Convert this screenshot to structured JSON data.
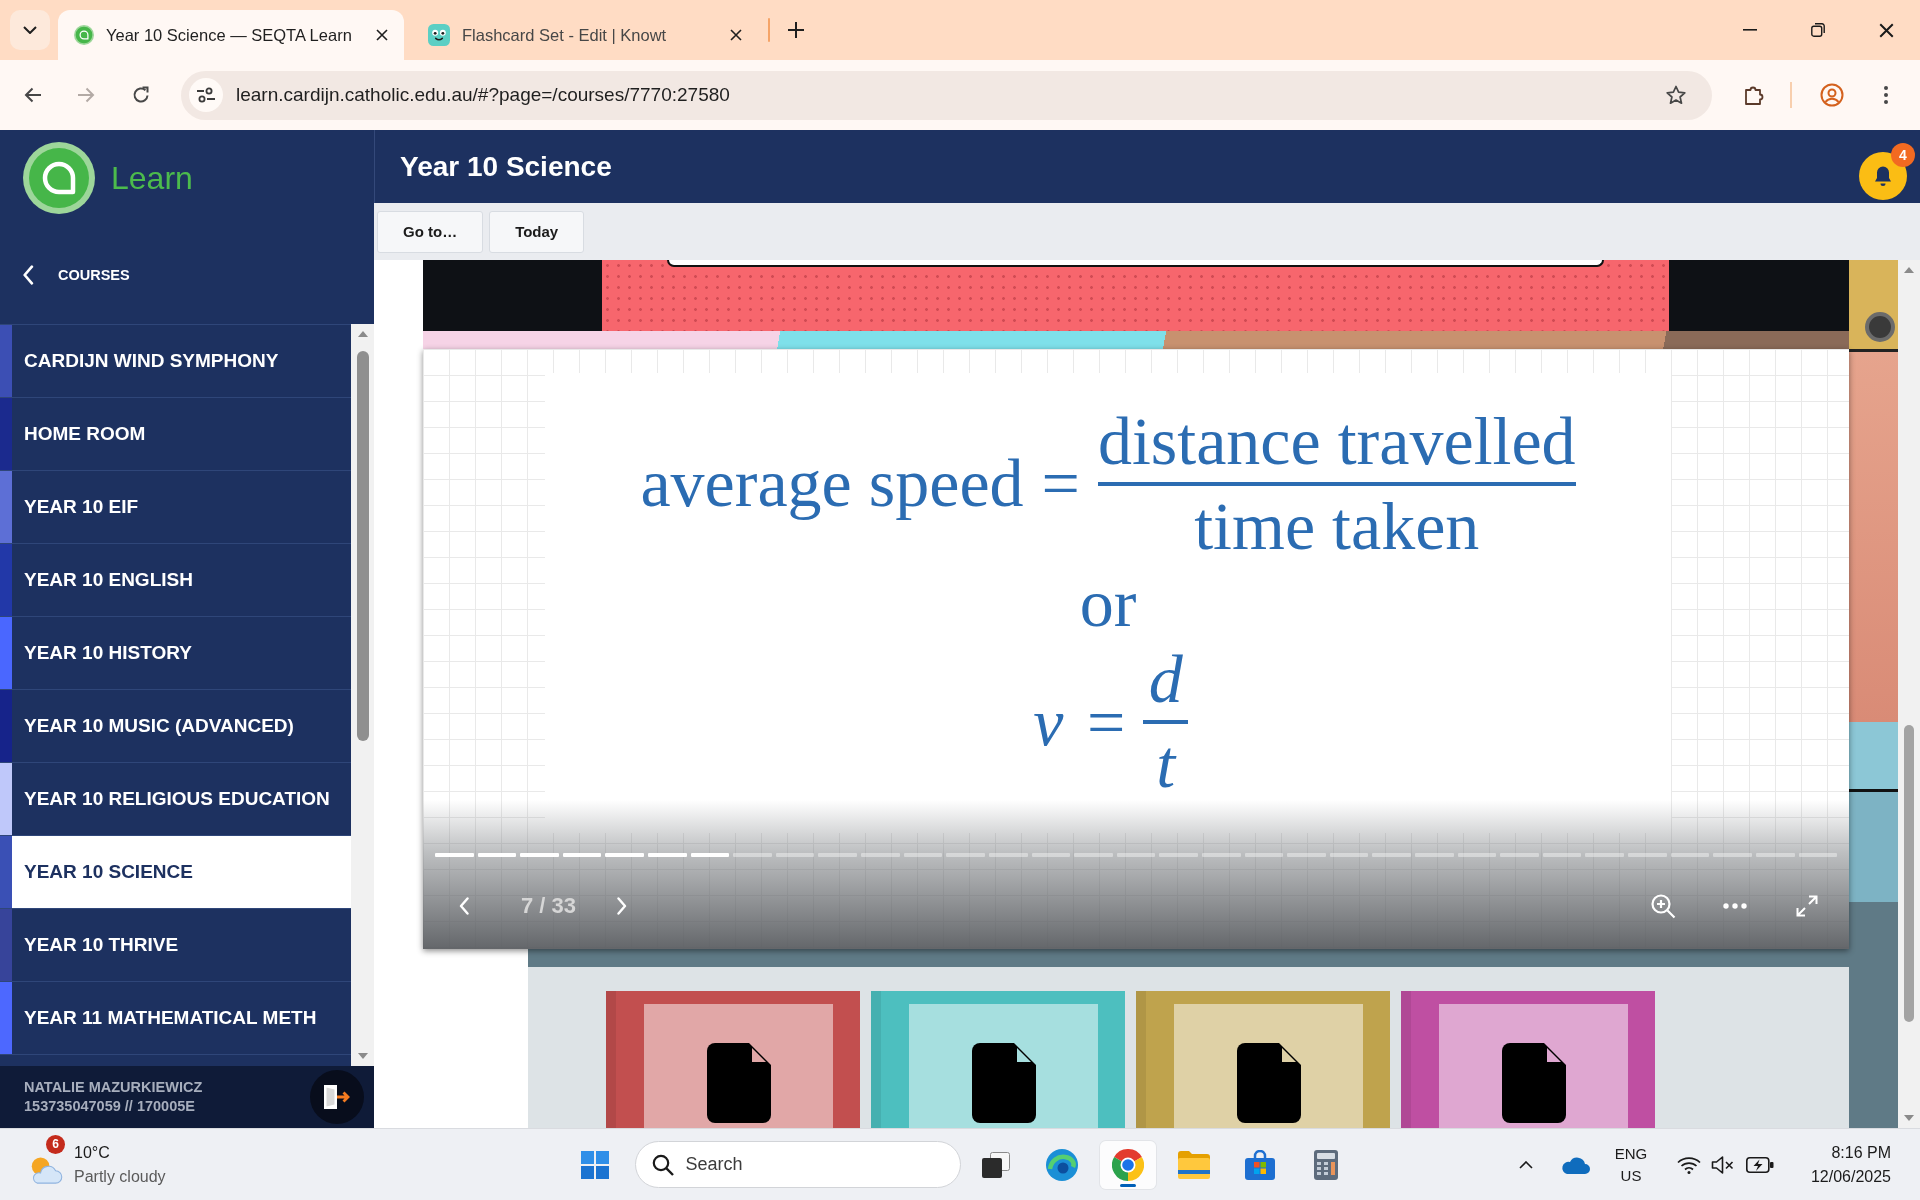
{
  "browser": {
    "tabs": [
      {
        "kind": "learn",
        "title": "Year 10 Science — SEQTA Learn",
        "selected": true
      },
      {
        "kind": "flashcards",
        "title": "Flashcard Set - Edit | Knowt",
        "selected": false
      }
    ],
    "forward_disabled": true,
    "url": "learn.cardijn.catholic.edu.au/#?page=/courses/7770:27580"
  },
  "sidebar": {
    "logo_text": "Learn",
    "back_label": "COURSES",
    "courses": [
      {
        "name": "CARDIJN WIND SYMPHONY",
        "color": "#3c4fb4",
        "selected": false
      },
      {
        "name": "HOME ROOM",
        "color": "#1b2a8e",
        "selected": false
      },
      {
        "name": "YEAR 10 EIF",
        "color": "#5d6fd6",
        "selected": false
      },
      {
        "name": "YEAR 10 ENGLISH",
        "color": "#2238a8",
        "selected": false
      },
      {
        "name": "YEAR 10 HISTORY",
        "color": "#4a67ff",
        "selected": false
      },
      {
        "name": "YEAR 10 MUSIC (ADVANCED)",
        "color": "#16238a",
        "selected": false
      },
      {
        "name": "YEAR 10 RELIGIOUS EDUCATION",
        "color": "#bfc8fa",
        "selected": false
      },
      {
        "name": "YEAR 10 SCIENCE",
        "color": "#3a50b5",
        "selected": true
      },
      {
        "name": "YEAR 10 THRIVE",
        "color": "#37449a",
        "selected": false
      },
      {
        "name": "YEAR 11 MATHEMATICAL METH",
        "color": "#4d68ff",
        "selected": false
      }
    ],
    "user": {
      "name": "NATALIE MAZURKIEWICZ",
      "id": "153735047059 // 170005E"
    }
  },
  "header": {
    "title": "Year 10 Science",
    "notification_count": "4"
  },
  "toolbar": {
    "buttons": [
      "Go to…",
      "Today"
    ]
  },
  "slide": {
    "equations": [
      {
        "kind": "words",
        "lhs": "average speed",
        "sign": "=",
        "numerator": "distance travelled",
        "denominator": "time taken"
      },
      {
        "kind": "symbols",
        "lhs": "v",
        "sign": "=",
        "numerator": "d",
        "denominator": "t"
      }
    ],
    "connector": "or",
    "progress": [
      {
        "done": true
      },
      {
        "done": true
      },
      {
        "done": true
      },
      {
        "done": true
      },
      {
        "done": true
      },
      {
        "done": true
      },
      {
        "done": true
      },
      {
        "done": false
      },
      {
        "done": false
      },
      {
        "done": false
      },
      {
        "done": false
      },
      {
        "done": false
      },
      {
        "done": false
      },
      {
        "done": false
      },
      {
        "done": false
      },
      {
        "done": false
      },
      {
        "done": false
      },
      {
        "done": false
      },
      {
        "done": false
      },
      {
        "done": false
      },
      {
        "done": false
      },
      {
        "done": false
      },
      {
        "done": false
      },
      {
        "done": false
      },
      {
        "done": false
      },
      {
        "done": false
      },
      {
        "done": false
      },
      {
        "done": false
      },
      {
        "done": false
      },
      {
        "done": false
      },
      {
        "done": false
      },
      {
        "done": false
      },
      {
        "done": false
      }
    ],
    "counter": "7 / 33"
  },
  "resources": [
    {
      "color": "#c24f4f"
    },
    {
      "color": "#4dbfbf"
    },
    {
      "color": "#bfa34d"
    },
    {
      "color": "#bf4fa2"
    }
  ],
  "taskbar": {
    "weather": {
      "alert_count": "6",
      "temperature": "10°C",
      "condition": "Partly cloudy"
    },
    "search": {
      "placeholder": "Search"
    },
    "apps": [
      {
        "kind": "taskview",
        "selected": false
      },
      {
        "kind": "swirl",
        "selected": false
      },
      {
        "kind": "browser",
        "selected": true
      },
      {
        "kind": "folder",
        "selected": false
      },
      {
        "kind": "store",
        "selected": false
      },
      {
        "kind": "calculator",
        "selected": false
      }
    ],
    "language": {
      "line_1": "ENG",
      "line_2": "US"
    },
    "clock": {
      "time": "8:16 PM",
      "date": "12/06/2025"
    }
  }
}
